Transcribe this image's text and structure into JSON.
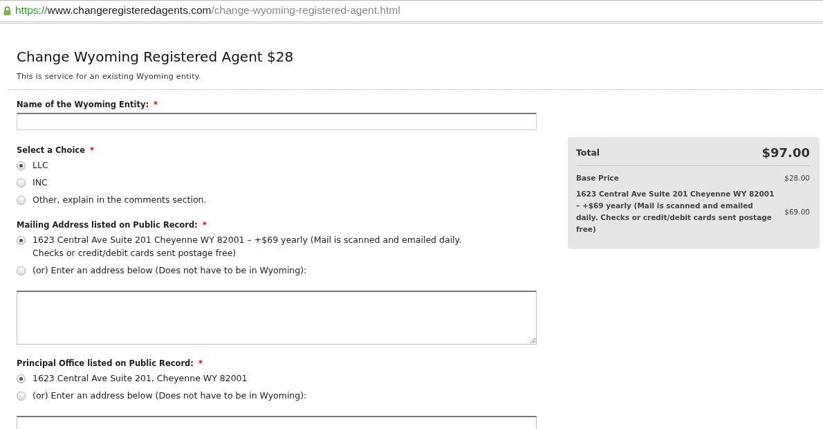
{
  "address_bar": {
    "scheme": "https://",
    "host": "www.changeregisteredagents.com",
    "path": "/change-wyoming-registered-agent.html",
    "secure": true
  },
  "page": {
    "title": "Change Wyoming Registered Agent $28",
    "subtitle": "This is service for an existing Wyoming entity."
  },
  "fields": [
    {
      "kind": "text",
      "label": "Name of the Wyoming Entity:",
      "required_mark": "*"
    },
    {
      "kind": "radio",
      "label": "Select a Choice",
      "required_mark": "*",
      "options": [
        {
          "label": "LLC",
          "selected": true
        },
        {
          "label": "INC",
          "selected": false
        },
        {
          "label": "Other, explain in the comments section.",
          "selected": false
        }
      ]
    },
    {
      "kind": "radio",
      "label": "Mailing Address listed on Public Record:",
      "required_mark": "*",
      "options": [
        {
          "label": "1623 Central Ave Suite 201 Cheyenne WY 82001 – +$69 yearly (Mail is scanned and emailed daily. Checks or credit/debit cards sent postage free)",
          "selected": true
        },
        {
          "label": "(or) Enter an address below (Does not have to be in Wyoming):",
          "selected": false
        }
      ]
    },
    {
      "kind": "textarea"
    },
    {
      "kind": "radio",
      "label": "Principal Office listed on Public Record:",
      "required_mark": "*",
      "options": [
        {
          "label": "1623 Central Ave Suite 201, Cheyenne WY 82001",
          "selected": true
        },
        {
          "label": "(or) Enter an address below (Does not have to be in Wyoming):",
          "selected": false
        }
      ]
    },
    {
      "kind": "textarea"
    }
  ],
  "summary": {
    "total_label": "Total",
    "total": "$97.00",
    "lines": [
      {
        "label": "Base Price",
        "amount": "$28.00"
      },
      {
        "label": "1623 Central Ave Suite 201 Cheyenne WY 82001 – +$69 yearly (Mail is scanned and emailed daily. Checks or credit/debit cards sent postage free)",
        "amount": "$69.00"
      }
    ]
  }
}
